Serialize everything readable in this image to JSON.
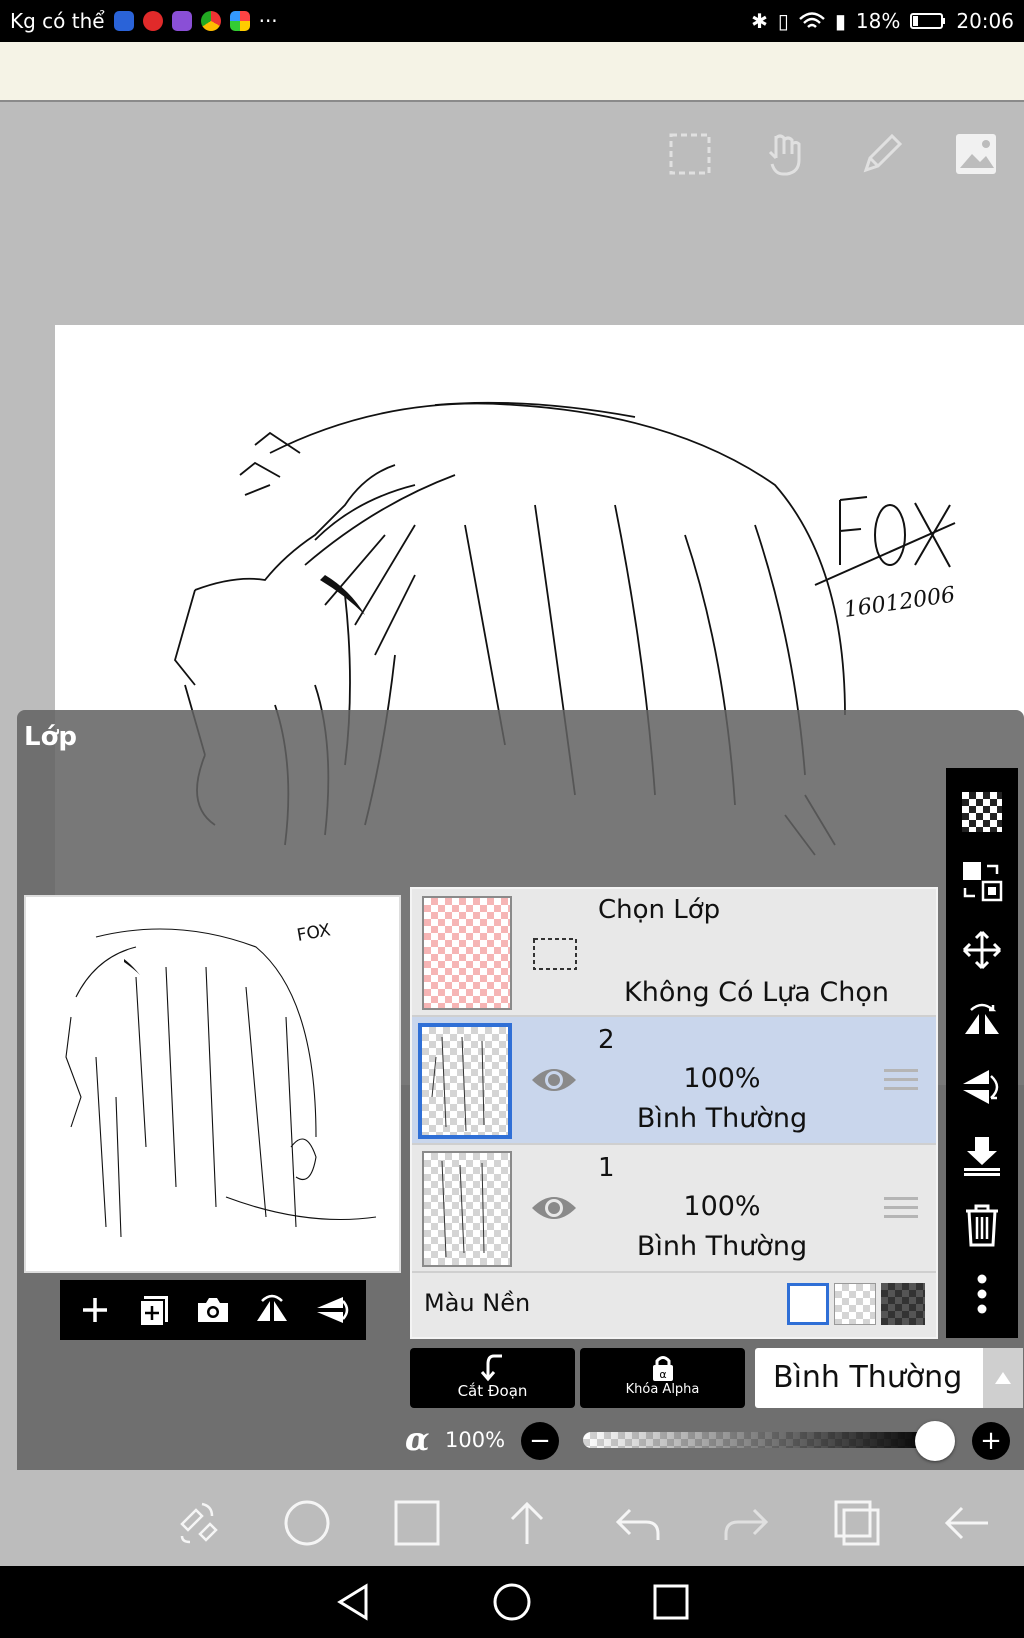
{
  "status_bar": {
    "notification": "Kg có thể",
    "battery": "18%",
    "time": "20:06",
    "more": "···"
  },
  "panel": {
    "title": "Lớp"
  },
  "artwork": {
    "signature": "FOX",
    "date": "16012006"
  },
  "layers": {
    "selection": {
      "label": "Chọn Lớp",
      "status": "Không Có Lựa Chọn"
    },
    "items": [
      {
        "name": "2",
        "opacity": "100%",
        "blend": "Bình Thường",
        "selected": true
      },
      {
        "name": "1",
        "opacity": "100%",
        "blend": "Bình Thường",
        "selected": false
      }
    ],
    "background_label": "Màu Nền"
  },
  "controls": {
    "clip_label": "Cắt Đoạn",
    "alpha_lock_label": "Khóa Alpha",
    "blend_mode": "Bình Thường",
    "alpha_symbol": "α",
    "alpha_value": "100%",
    "alpha_fraction": 1.0
  },
  "colors": {
    "selected_row": "#c9d6ec",
    "selected_border": "#2f6fd6",
    "panel_bg": "#626262"
  }
}
